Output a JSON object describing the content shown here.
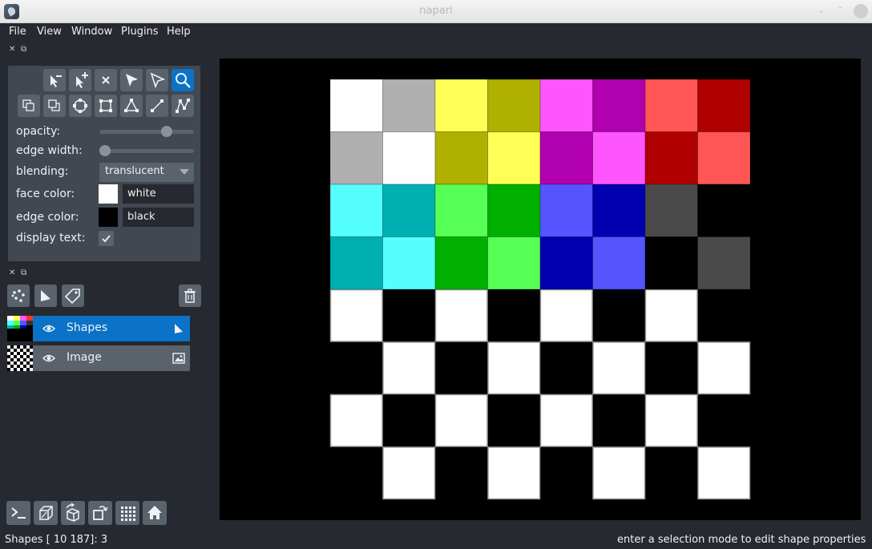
{
  "window": {
    "title": "napari"
  },
  "menu": [
    "File",
    "View",
    "Window",
    "Plugins",
    "Help"
  ],
  "dock": {
    "close_glyph": "✕",
    "float_glyph": "⧉"
  },
  "layer_controls": {
    "opacity_label": "opacity:",
    "opacity_value": 0.74,
    "edge_width_label": "edge width:",
    "edge_width_value": 0.0,
    "blending_label": "blending:",
    "blending_value": "translucent",
    "face_color_label": "face color:",
    "face_color_name": "white",
    "face_color_hex": "#ffffff",
    "edge_color_label": "edge color:",
    "edge_color_name": "black",
    "edge_color_hex": "#000000",
    "display_text_label": "display text:",
    "display_text_checked": true,
    "tools_row1": [
      "remove-selected-point-icon",
      "add-point-icon",
      "delete-icon",
      "select-icon",
      "direct-select-icon",
      "pan-zoom-icon"
    ],
    "tools_row2": [
      "move-back-icon",
      "move-front-icon",
      "ellipse-icon",
      "rectangle-icon",
      "polygon-icon",
      "line-icon",
      "path-icon"
    ],
    "active_tool": "pan-zoom-icon"
  },
  "layers": [
    {
      "name": "Shapes",
      "selected": true,
      "visible": true,
      "type_icon": "shapes-layer-icon"
    },
    {
      "name": "Image",
      "selected": false,
      "visible": true,
      "type_icon": "image-layer-icon"
    }
  ],
  "layer_buttons": [
    "new-points-icon",
    "new-shapes-icon",
    "new-labels-icon",
    "delete-layer-icon"
  ],
  "viewer_buttons": [
    "console-icon",
    "ndisplay-icon",
    "roll-axes-icon",
    "transpose-icon",
    "grid-icon",
    "home-icon"
  ],
  "status": {
    "left": "Shapes [ 10 187]: 3",
    "right": "enter a selection mode to edit shape properties"
  },
  "canvas": {
    "top_rows": [
      [
        "#ffffff",
        "#b0b0b0",
        "#ffff55",
        "#b0b000",
        "#ff55ff",
        "#b000b0",
        "#ff5555",
        "#b00000"
      ],
      [
        "#b0b0b0",
        "#ffffff",
        "#b0b000",
        "#ffff55",
        "#b000b0",
        "#ff55ff",
        "#b00000",
        "#ff5555"
      ],
      [
        "#55ffff",
        "#00b0b0",
        "#55ff55",
        "#00b000",
        "#5555ff",
        "#0000b0",
        "#4a4a4a",
        "#000000"
      ],
      [
        "#00b0b0",
        "#55ffff",
        "#00b000",
        "#55ff55",
        "#0000b0",
        "#5555ff",
        "#000000",
        "#4a4a4a"
      ]
    ],
    "checker_light": "#ffffff",
    "checker_dark": "#000000"
  }
}
